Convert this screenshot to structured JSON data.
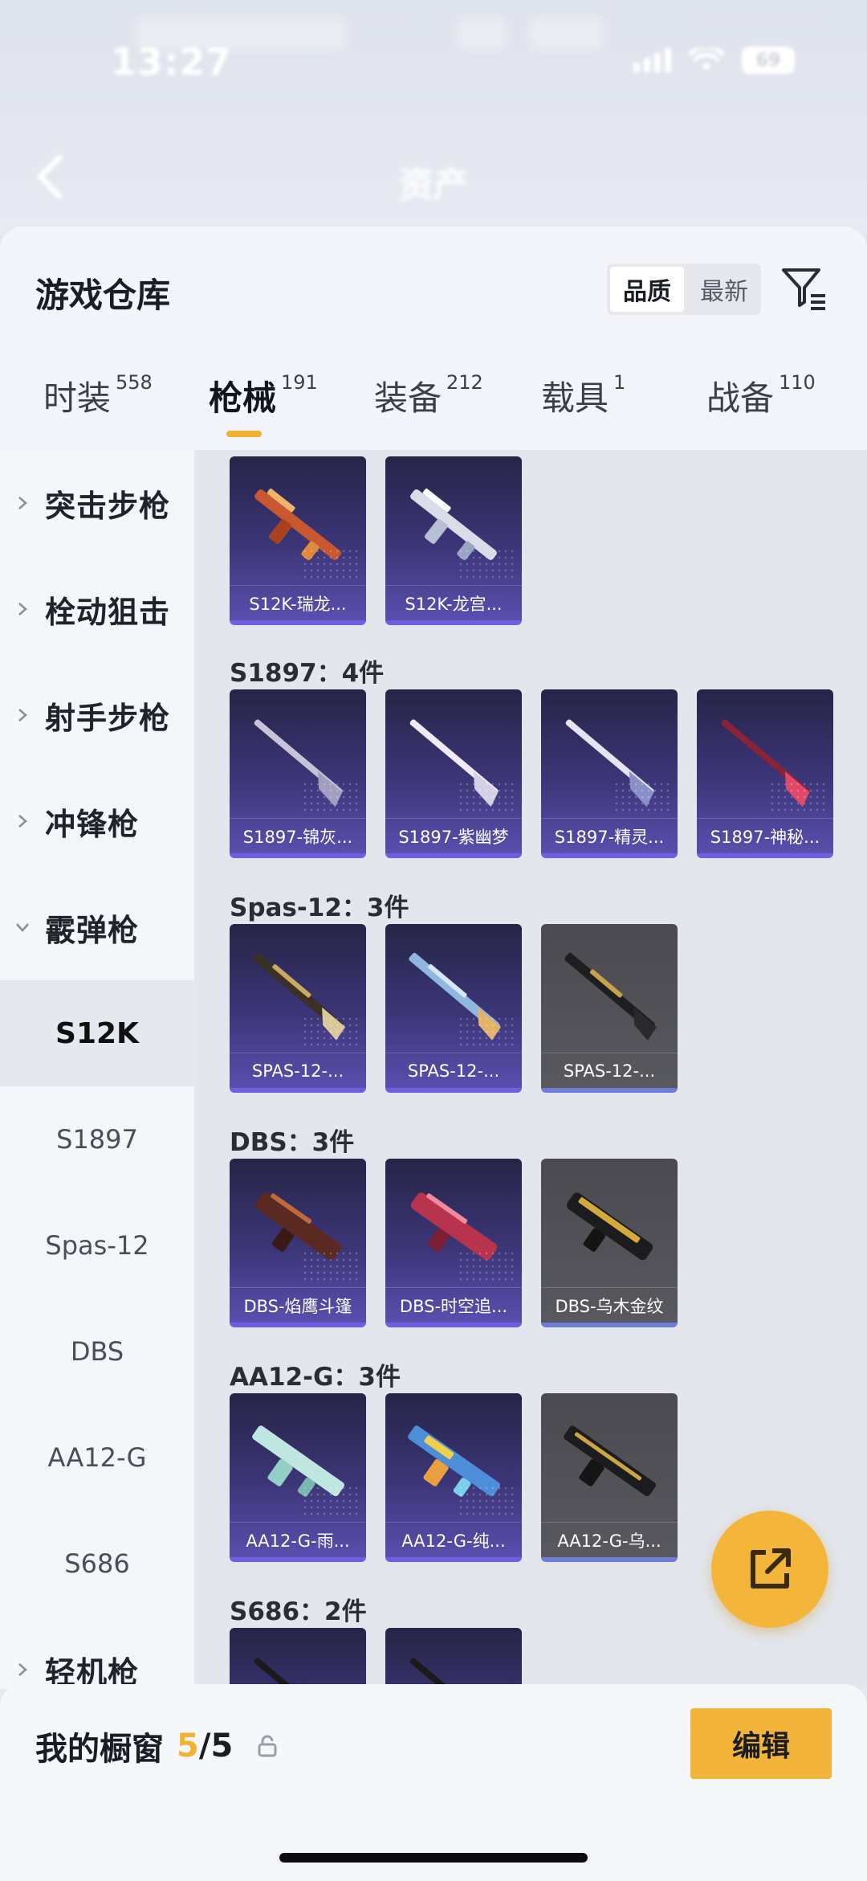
{
  "status_bar": {
    "time": "13:27",
    "battery": "69"
  },
  "nav": {
    "title": "资产"
  },
  "header": {
    "title": "游戏仓库",
    "sort_options": [
      "品质",
      "最新"
    ],
    "active_sort": "品质"
  },
  "category_tabs": [
    {
      "label": "时装",
      "count": "558"
    },
    {
      "label": "枪械",
      "count": "191"
    },
    {
      "label": "装备",
      "count": "212"
    },
    {
      "label": "载具",
      "count": "1"
    },
    {
      "label": "战备",
      "count": "110"
    }
  ],
  "active_category": "枪械",
  "sidebar": {
    "groups": [
      {
        "label": "突击步枪",
        "expanded": false
      },
      {
        "label": "栓动狙击",
        "expanded": false
      },
      {
        "label": "射手步枪",
        "expanded": false
      },
      {
        "label": "冲锋枪",
        "expanded": false
      },
      {
        "label": "霰弹枪",
        "expanded": true
      },
      {
        "label": "轻机枪",
        "expanded": false
      }
    ],
    "sub_items": [
      "S12K",
      "S1897",
      "Spas-12",
      "DBS",
      "AA12-G",
      "S686"
    ],
    "active_sub": "S12K"
  },
  "weapon_groups": [
    {
      "title": "",
      "items": [
        {
          "name": "S12K-瑞龙...",
          "rarity": "purple"
        },
        {
          "name": "S12K-龙宫...",
          "rarity": "purple"
        }
      ]
    },
    {
      "title": "S1897：4件",
      "items": [
        {
          "name": "S1897-锦灰...",
          "rarity": "purple"
        },
        {
          "name": "S1897-紫幽梦",
          "rarity": "purple"
        },
        {
          "name": "S1897-精灵...",
          "rarity": "purple"
        },
        {
          "name": "S1897-神秘...",
          "rarity": "purple"
        }
      ]
    },
    {
      "title": "Spas-12：3件",
      "items": [
        {
          "name": "SPAS-12-...",
          "rarity": "purple"
        },
        {
          "name": "SPAS-12-...",
          "rarity": "purple"
        },
        {
          "name": "SPAS-12-...",
          "rarity": "grey"
        }
      ]
    },
    {
      "title": "DBS：3件",
      "items": [
        {
          "name": "DBS-焰鹰斗篷",
          "rarity": "purple"
        },
        {
          "name": "DBS-时空追...",
          "rarity": "purple"
        },
        {
          "name": "DBS-乌木金纹",
          "rarity": "grey"
        }
      ]
    },
    {
      "title": "AA12-G：3件",
      "items": [
        {
          "name": "AA12-G-雨...",
          "rarity": "purple"
        },
        {
          "name": "AA12-G-纯...",
          "rarity": "purple"
        },
        {
          "name": "AA12-G-乌...",
          "rarity": "grey"
        }
      ]
    },
    {
      "title": "S686：2件",
      "items": [
        {
          "name": "",
          "rarity": "purple"
        },
        {
          "name": "",
          "rarity": "purple"
        }
      ]
    }
  ],
  "showcase": {
    "label": "我的橱窗",
    "used": "5",
    "total": "5"
  },
  "edit_button": "编辑",
  "colors": {
    "accent": "#f2b43a",
    "purple_card": "#3c3678",
    "grey_card": "#55555c"
  },
  "icons": [
    "back-arrow-icon",
    "filter-icon",
    "chevron-right-icon",
    "chevron-down-icon",
    "share-icon",
    "lock-icon"
  ]
}
